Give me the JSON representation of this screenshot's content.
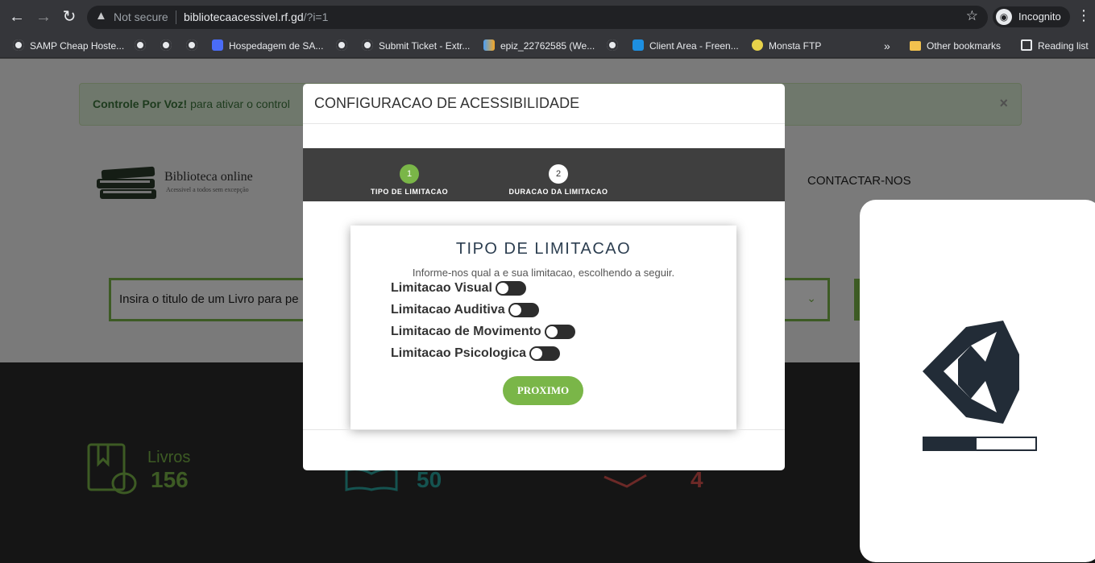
{
  "browser": {
    "not_secure": "Not secure",
    "url_host": "bibliotecaacessivel.rf.gd",
    "url_path": "/?i=1",
    "incognito": "Incognito",
    "bookmarks": [
      {
        "label": "SAMP Cheap Hoste...",
        "icon": "globe-icon"
      },
      {
        "label": "",
        "icon": "globe-icon"
      },
      {
        "label": "",
        "icon": "globe-icon"
      },
      {
        "label": "",
        "icon": "globe-icon"
      },
      {
        "label": "Hospedagem de SA...",
        "icon": "site-icon"
      },
      {
        "label": "",
        "icon": "globe-icon"
      },
      {
        "label": "Submit Ticket - Extr...",
        "icon": "globe-icon"
      },
      {
        "label": "epiz_22762585 (We...",
        "icon": "infinity-icon"
      },
      {
        "label": "",
        "icon": "globe-icon"
      },
      {
        "label": "Client Area - Freen...",
        "icon": "in-icon"
      },
      {
        "label": "Monsta FTP",
        "icon": "monsta-icon"
      }
    ],
    "overflow": "»",
    "other_bookmarks": "Other bookmarks",
    "reading_list": "Reading list"
  },
  "page": {
    "alert_bold": "Controle Por Voz!",
    "alert_text": " para ativar o control",
    "alert_close": "×",
    "logo_title": "Biblioteca online",
    "logo_sub": "Acessivel a todos sem excepção",
    "nav_contact": "CONTACTAR-NOS",
    "search_placeholder": "Insira o titulo de um Livro para pe",
    "stats": [
      {
        "label": "Livros",
        "value": "156",
        "color": "#7ab648"
      },
      {
        "label": "",
        "value": "50",
        "color": "#2aa7a0"
      },
      {
        "label": "",
        "value": "4",
        "color": "#d9534f"
      }
    ]
  },
  "modal": {
    "title": "CONFIGURACAO DE ACESSIBILIDADE",
    "steps": [
      {
        "num": "1",
        "label": "TIPO DE LIMITACAO",
        "active": true
      },
      {
        "num": "2",
        "label": "DURACAO DA LIMITACAO",
        "active": false
      }
    ],
    "card_title": "TIPO DE LIMITACAO",
    "card_subtitle": "Informe-nos qual a e sua limitacao, escolhendo a seguir.",
    "options": [
      {
        "label": "Limitacao Visual",
        "on": false
      },
      {
        "label": "Limitacao Auditiva",
        "on": false
      },
      {
        "label": "Limitacao de Movimento",
        "on": false
      },
      {
        "label": "Limitacao Psicologica",
        "on": false
      }
    ],
    "next_button": "PROXIMO"
  },
  "loader": {
    "progress": 0.47,
    "logo_color": "#222c37"
  },
  "colors": {
    "accent": "#7ab648",
    "step_bar": "#3f3f3f"
  }
}
